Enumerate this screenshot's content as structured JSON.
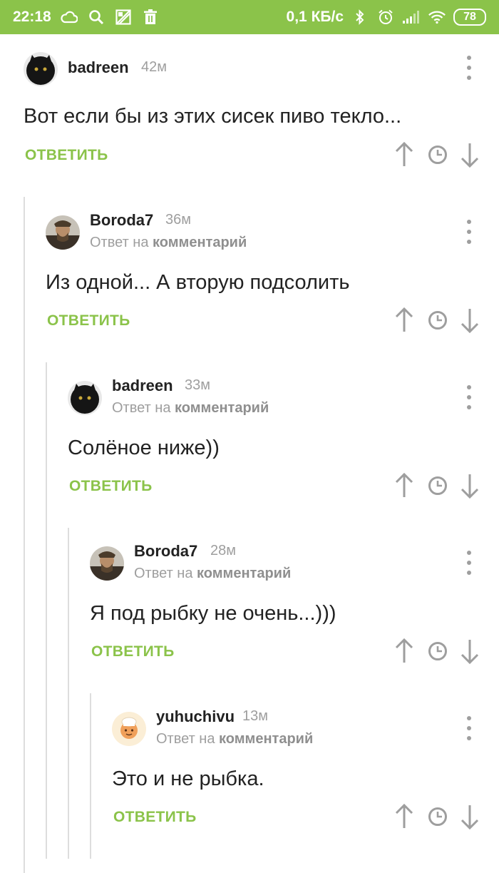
{
  "status_bar": {
    "time": "22:18",
    "speed": "0,1 КБ/с",
    "battery": "78",
    "left_icons": [
      "cloud-icon",
      "search-icon",
      "image-icon",
      "trash-icon"
    ],
    "right_icons": [
      "bluetooth-icon",
      "alarm-icon",
      "signal-icon",
      "wifi-icon"
    ]
  },
  "accent_color": "#8bc34a",
  "labels": {
    "reply": "ОТВЕТИТЬ",
    "reply_to_prefix": "Ответ на",
    "reply_to_target": "комментарий"
  },
  "comments": [
    {
      "author": "badreen",
      "time": "42м",
      "text": "Вот если бы из этих сисек пиво текло...",
      "is_reply": false
    },
    {
      "author": "Boroda7",
      "time": "36м",
      "text": "Из одной... А вторую подсолить",
      "is_reply": true
    },
    {
      "author": "badreen",
      "time": "33м",
      "text": "Солёное ниже))",
      "is_reply": true
    },
    {
      "author": "Boroda7",
      "time": "28м",
      "text": "Я под рыбку не очень...)))",
      "is_reply": true
    },
    {
      "author": "yuhuchivu",
      "time": "13м",
      "text": "Это и не рыбка.",
      "is_reply": true
    }
  ]
}
